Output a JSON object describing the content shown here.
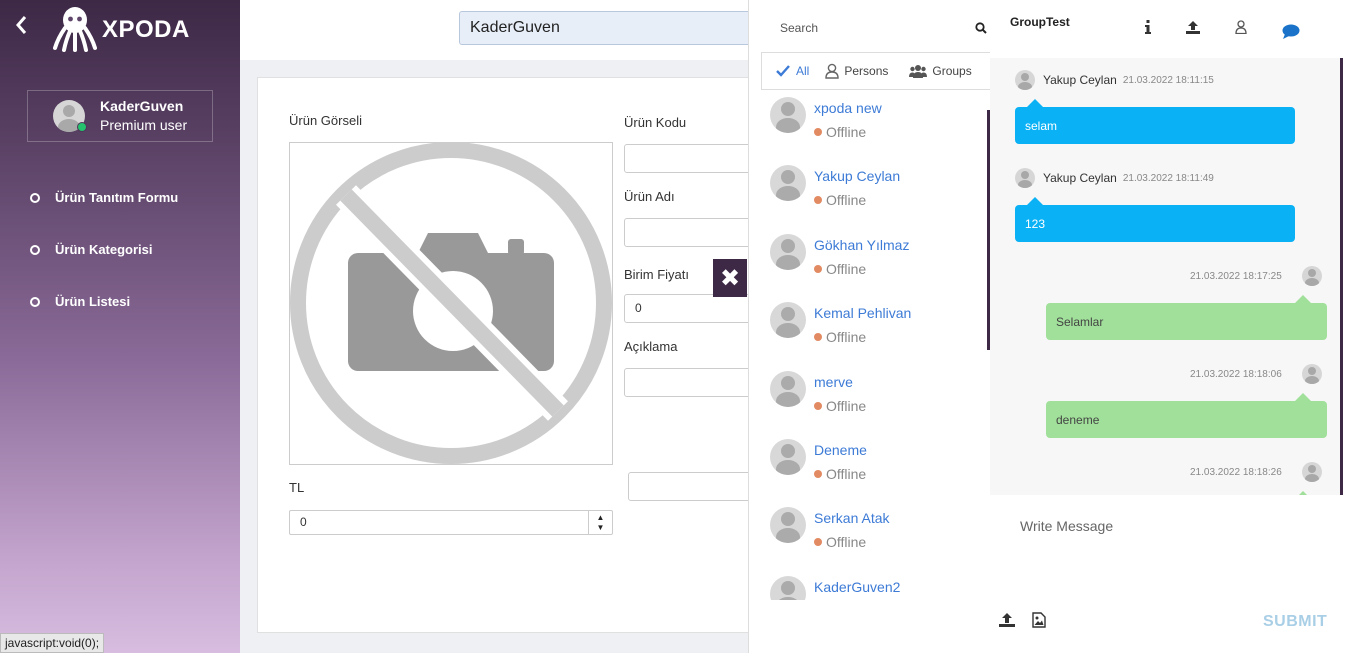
{
  "sidebar": {
    "logo_text": "XPODA",
    "user": {
      "name": "KaderGuven",
      "role": "Premium user"
    },
    "nav_items": [
      {
        "label": "Ürün Tanıtım Formu"
      },
      {
        "label": "Ürün Kategorisi"
      },
      {
        "label": "Ürün Listesi"
      }
    ]
  },
  "statusbar": {
    "text": "javascript:void(0);"
  },
  "topbar": {
    "search_value": "KaderGuven"
  },
  "form": {
    "image_label": "Ürün Görseli",
    "code_label": "Ürün Kodu",
    "name_label": "Ürün Adı",
    "price_label": "Birim Fiyatı",
    "price_value": "0",
    "description_label": "Açıklama",
    "currency_label": "TL",
    "currency_value": "0"
  },
  "contacts": {
    "search_placeholder": "Search",
    "filters": {
      "all": "All",
      "persons": "Persons",
      "groups": "Groups"
    },
    "list": [
      {
        "name": "xpoda new",
        "status": "Offline"
      },
      {
        "name": "Yakup Ceylan",
        "status": "Offline"
      },
      {
        "name": "Gökhan Yılmaz",
        "status": "Offline"
      },
      {
        "name": "Kemal Pehlivan",
        "status": "Offline"
      },
      {
        "name": "merve",
        "status": "Offline"
      },
      {
        "name": "Deneme",
        "status": "Offline"
      },
      {
        "name": "Serkan Atak",
        "status": "Offline"
      },
      {
        "name": "KaderGuven2",
        "status": ""
      }
    ]
  },
  "chat": {
    "title": "GroupTest",
    "messages": [
      {
        "author": "Yakup Ceylan",
        "time": "21.03.2022 18:11:15",
        "text": "selam",
        "direction": "in"
      },
      {
        "author": "Yakup Ceylan",
        "time": "21.03.2022 18:11:49",
        "text": "123",
        "direction": "in"
      },
      {
        "author": "",
        "time": "21.03.2022 18:17:25",
        "text": "Selamlar",
        "direction": "out"
      },
      {
        "author": "",
        "time": "21.03.2022 18:18:06",
        "text": "deneme",
        "direction": "out"
      },
      {
        "author": "",
        "time": "21.03.2022 18:18:26",
        "text": "",
        "direction": "out"
      }
    ],
    "input_placeholder": "Write Message",
    "submit_label": "SUBMIT"
  },
  "colors": {
    "accent": "#3d2846",
    "incoming_bubble": "#0ab1f5",
    "outgoing_bubble": "#a1e09a",
    "link": "#3d7bd6",
    "offline": "#e28a62"
  }
}
